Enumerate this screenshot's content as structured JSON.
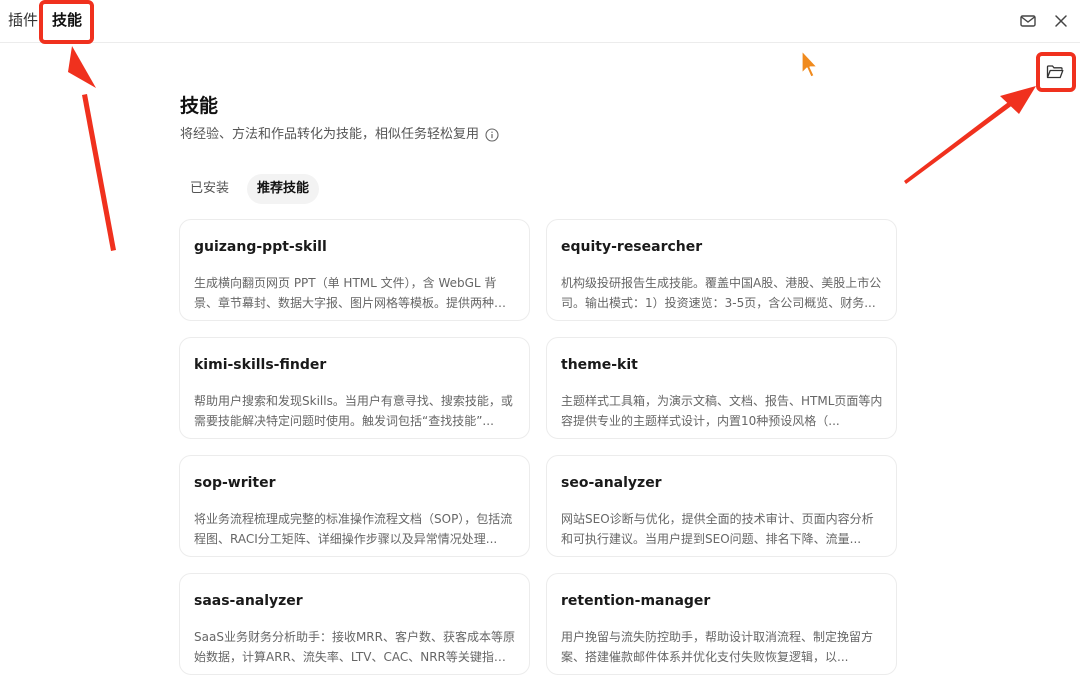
{
  "topbar": {
    "tabs": [
      {
        "label": "插件"
      },
      {
        "label": "技能"
      }
    ]
  },
  "header": {
    "title": "技能",
    "subtitle": "将经验、方法和作品转化为技能，相似任务轻松复用"
  },
  "segment_tabs": [
    {
      "label": "已安装",
      "active": false
    },
    {
      "label": "推荐技能",
      "active": true
    }
  ],
  "cards": [
    {
      "title": "guizang-ppt-skill",
      "desc": "生成横向翻页网页 PPT（单 HTML 文件），含 WebGL 背景、章节幕封、数据大字报、图片网格等模板。提供两种风格..."
    },
    {
      "title": "equity-researcher",
      "desc": "机构级投研报告生成技能。覆盖中国A股、港股、美股上市公司。输出模式：1）投资速览：3-5页，含公司概览、财务..."
    },
    {
      "title": "kimi-skills-finder",
      "desc": "帮助用户搜索和发现Skills。当用户有意寻找、搜索技能，或需要技能解决特定问题时使用。触发词包括“查找技能”..."
    },
    {
      "title": "theme-kit",
      "desc": "主题样式工具箱，为演示文稿、文档、报告、HTML页面等内容提供专业的主题样式设计，内置10种预设风格（..."
    },
    {
      "title": "sop-writer",
      "desc": "将业务流程梳理成完整的标准操作流程文档（SOP），包括流程图、RACI分工矩阵、详细操作步骤以及异常情况处理..."
    },
    {
      "title": "seo-analyzer",
      "desc": "网站SEO诊断与优化，提供全面的技术审计、页面内容分析和可执行建议。当用户提到SEO问题、排名下降、流量..."
    },
    {
      "title": "saas-analyzer",
      "desc": "SaaS业务财务分析助手：接收MRR、客户数、获客成本等原始数据，计算ARR、流失率、LTV、CAC、NRR等关键指标..."
    },
    {
      "title": "retention-manager",
      "desc": "用户挽留与流失防控助手，帮助设计取消流程、制定挽留方案、搭建催款邮件体系并优化支付失败恢复逻辑，以..."
    }
  ],
  "colors": {
    "highlight": "#f0311e",
    "cursor": "#f08a1d"
  },
  "icons": {
    "mail": "mail-icon",
    "close": "close-icon",
    "folder": "folder-icon",
    "info": "info-icon"
  }
}
